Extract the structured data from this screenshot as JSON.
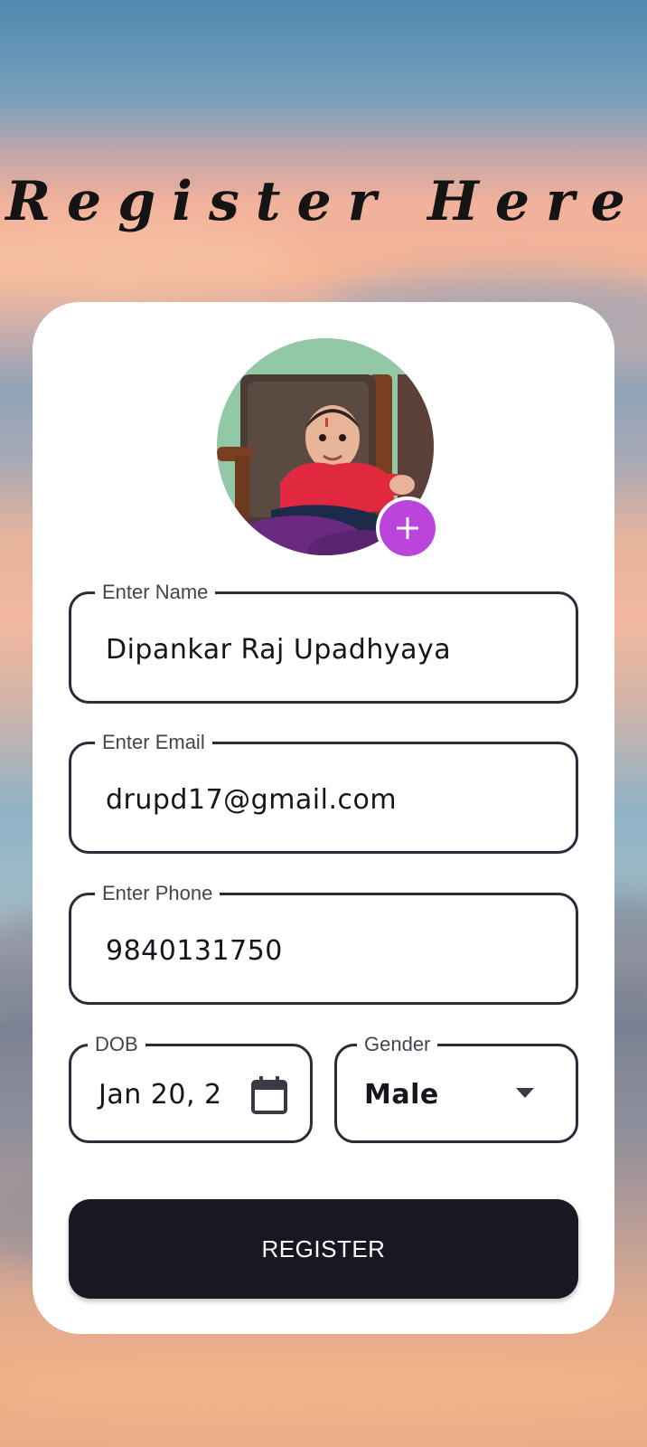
{
  "header": {
    "title": "Register Here"
  },
  "form": {
    "name": {
      "label": "Enter Name",
      "value": "Dipankar Raj Upadhyaya"
    },
    "email": {
      "label": "Enter Email",
      "value": "drupd17@gmail.com"
    },
    "phone": {
      "label": "Enter Phone",
      "value": "9840131750"
    },
    "dob": {
      "label": "DOB",
      "value": "Jan 20, 2"
    },
    "gender": {
      "label": "Gender",
      "value": "Male"
    }
  },
  "actions": {
    "register_label": "REGISTER"
  },
  "icons": {
    "add_photo": "plus-icon",
    "calendar": "calendar-icon",
    "dropdown": "arrow-drop-down-icon"
  },
  "colors": {
    "accent": "#bb44dd",
    "button": "#181822",
    "field_border": "#2c2b3a"
  }
}
